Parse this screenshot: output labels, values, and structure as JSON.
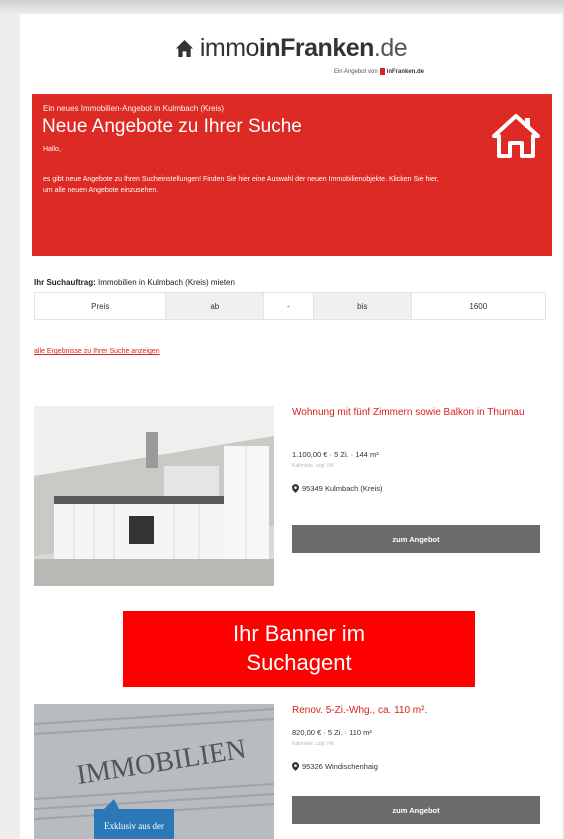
{
  "logo": {
    "part1": "immo",
    "part2": "inFranken",
    "tld": ".de",
    "sub_prefix": "Ein Angebot von",
    "sub_brand": "inFranken.de",
    "icon": "house-icon"
  },
  "hero": {
    "small": "Ein neues Immobilien-Angebot in Kulmbach (Kreis)",
    "title": "Neue Angebote zu Ihrer Suche",
    "hello": "Hallo,",
    "body": "es gibt neue Angebote zu Ihren Sucheinstellungen! Finden Sie hier eine Auswahl der neuen Immobilienobjekte. Klicken Sie hier, um alle neuen Angebote einzusehen.",
    "icon": "house-icon",
    "color": "#dd2a24"
  },
  "search": {
    "label_bold": "Ihr Suchauftrag:",
    "label_rest": " Immobilien in Kulmbach (Kreis) mieten",
    "filter": [
      "Preis",
      "ab",
      "-",
      "bis",
      "1600"
    ]
  },
  "all_results_link": "alle Ergebnisse zu Ihrer Suche anzeigen",
  "listings": [
    {
      "title": "Wohnung mit fünf Zimmern sowie Balkon in Thurnau",
      "price": "1.100,00 € · 5 Zi. · 144 m²",
      "note": "Kaltmiete, zzgl. NK",
      "location": "95349 Kulmbach (Kreis)",
      "button": "zum Angebot"
    },
    {
      "title": "Renov. 5-Zi.-Whg., ca. 110 m².",
      "price": "820,00 € · 5 Zi. · 110 m²",
      "note": "Kaltmiete, zzgl. NK",
      "location": "95326 Windischenhaig",
      "button": "zum Angebot"
    }
  ],
  "banner": {
    "line1": "Ihr Banner im",
    "line2": "Suchagent",
    "color": "#ff0000"
  },
  "listing2_image_text": {
    "headline": "IMMOBILIEN",
    "tag": "Exklusiv aus der"
  }
}
